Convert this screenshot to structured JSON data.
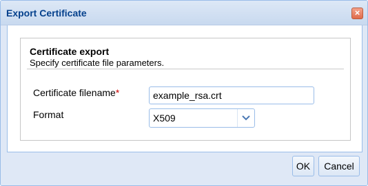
{
  "dialog": {
    "title": "Export Certificate",
    "close_icon": "close-icon"
  },
  "section": {
    "title": "Certificate export",
    "subtitle": "Specify certificate file parameters."
  },
  "form": {
    "filename_label": "Certificate filename",
    "required_marker": "*",
    "filename_value": "example_rsa.crt",
    "format_label": "Format",
    "format_value": "X509",
    "format_icon": "chevron-down-icon"
  },
  "buttons": {
    "ok": "OK",
    "cancel": "Cancel"
  },
  "colors": {
    "title_text": "#04408c",
    "border": "#99bce8",
    "required": "#cc0000",
    "close_button": "#e06a4a"
  }
}
